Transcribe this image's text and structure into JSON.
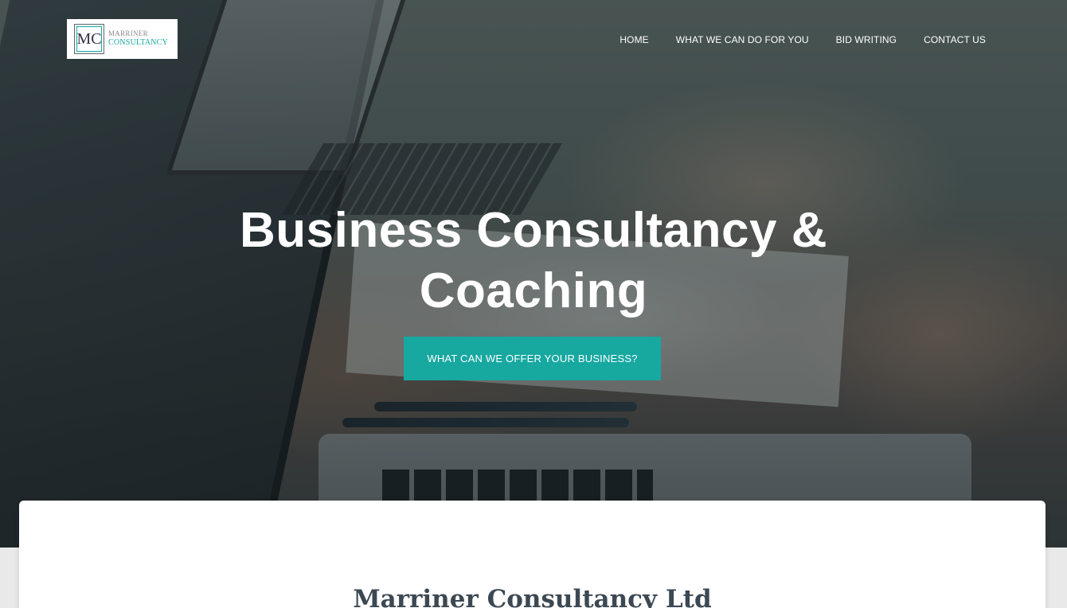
{
  "logo": {
    "mark": "MC",
    "line1": "MARRINER",
    "line2": "CONSULTANCY"
  },
  "nav": {
    "items": [
      {
        "label": "HOME"
      },
      {
        "label": "WHAT WE CAN DO FOR YOU"
      },
      {
        "label": "BID WRITING"
      },
      {
        "label": "CONTACT US"
      }
    ]
  },
  "hero": {
    "title_line1": "Business Consultancy &",
    "title_line2": "Coaching",
    "cta_label": "WHAT CAN WE OFFER YOUR BUSINESS?"
  },
  "section": {
    "title": "Marriner Consultancy Ltd"
  },
  "colors": {
    "accent": "#17a8a0",
    "heading": "#3c4852"
  }
}
